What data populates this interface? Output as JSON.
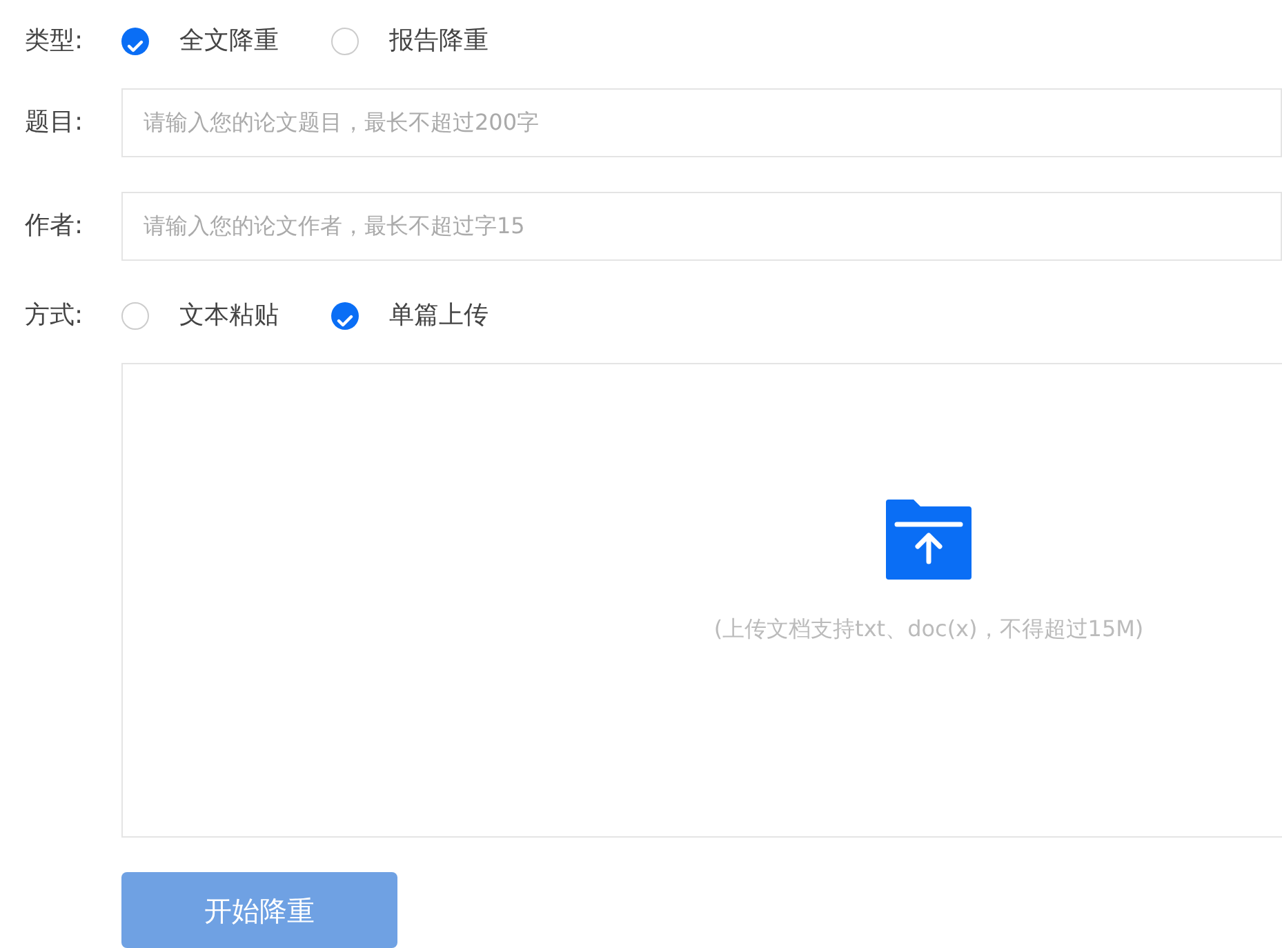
{
  "type_row": {
    "label": "类型:",
    "options": [
      {
        "label": "全文降重",
        "selected": true
      },
      {
        "label": "报告降重",
        "selected": false
      }
    ]
  },
  "title_row": {
    "label": "题目:",
    "placeholder": "请输入您的论文题目，最长不超过200字"
  },
  "author_row": {
    "label": "作者:",
    "placeholder": "请输入您的论文作者，最长不超过字15"
  },
  "method_row": {
    "label": "方式:",
    "options": [
      {
        "label": "文本粘贴",
        "selected": false
      },
      {
        "label": "单篇上传",
        "selected": true
      }
    ]
  },
  "upload": {
    "hint": "(上传文档支持txt、doc(x)，不得超过15M)"
  },
  "submit": {
    "label": "开始降重",
    "disabled": true
  }
}
